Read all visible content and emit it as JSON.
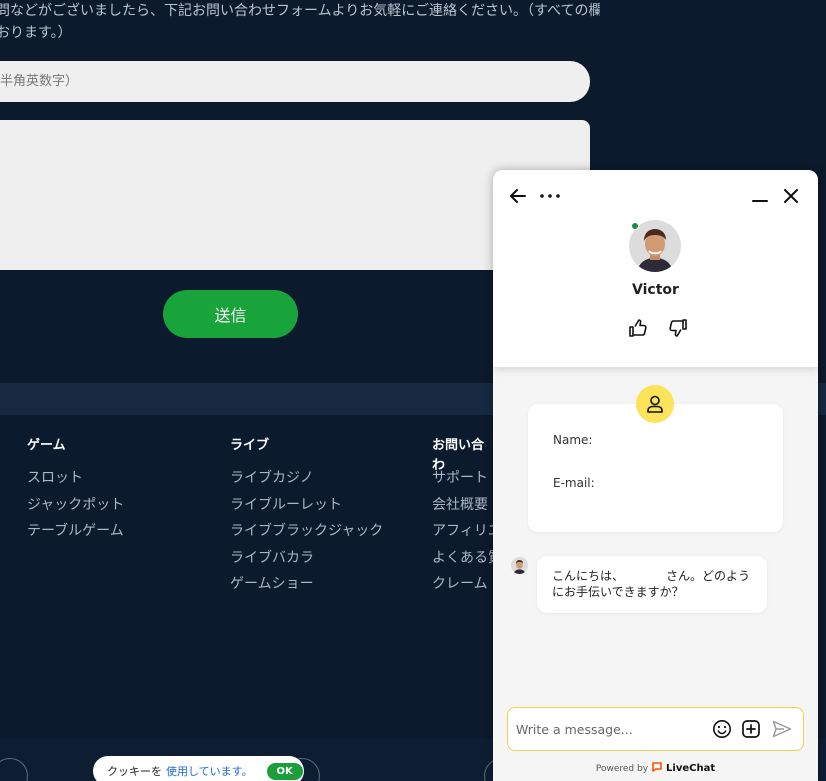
{
  "page": {
    "intro_line1": "問などがございましたら、下記お問い合わせフォームよりお気軽にご連絡ください。（すべての欄",
    "intro_line2": "おります。）",
    "email_placeholder": "半角英数字）",
    "submit_label": "送信"
  },
  "footer": {
    "columns": [
      {
        "heading": "ゲーム",
        "links": [
          "スロット",
          "ジャックポット",
          "テーブルゲーム"
        ]
      },
      {
        "heading": "ライブ",
        "links": [
          "ライブカジノ",
          "ライブルーレット",
          "ライブブラックジャック",
          "ライブバカラ",
          "ゲームショー"
        ]
      },
      {
        "heading": "お問い合わ",
        "links": [
          "サポート",
          "会社概要",
          "アフィリエ",
          "よくある質",
          "クレーム"
        ]
      }
    ]
  },
  "cookie": {
    "text": "クッキーを",
    "link": "使用しています。",
    "ok_label": "OK"
  },
  "chat": {
    "agent_name": "Victor",
    "form": {
      "name_label": "Name:",
      "email_label": "E-mail:"
    },
    "message": "こんにちは、　　　　さん。どのようにお手伝いできますか？",
    "composer_placeholder": "Write a message...",
    "powered_by": "Powered by",
    "brand": "LiveChat",
    "colors": {
      "accent": "#fce35a",
      "online": "#1e8a4a",
      "brand": "#ff5100"
    }
  }
}
